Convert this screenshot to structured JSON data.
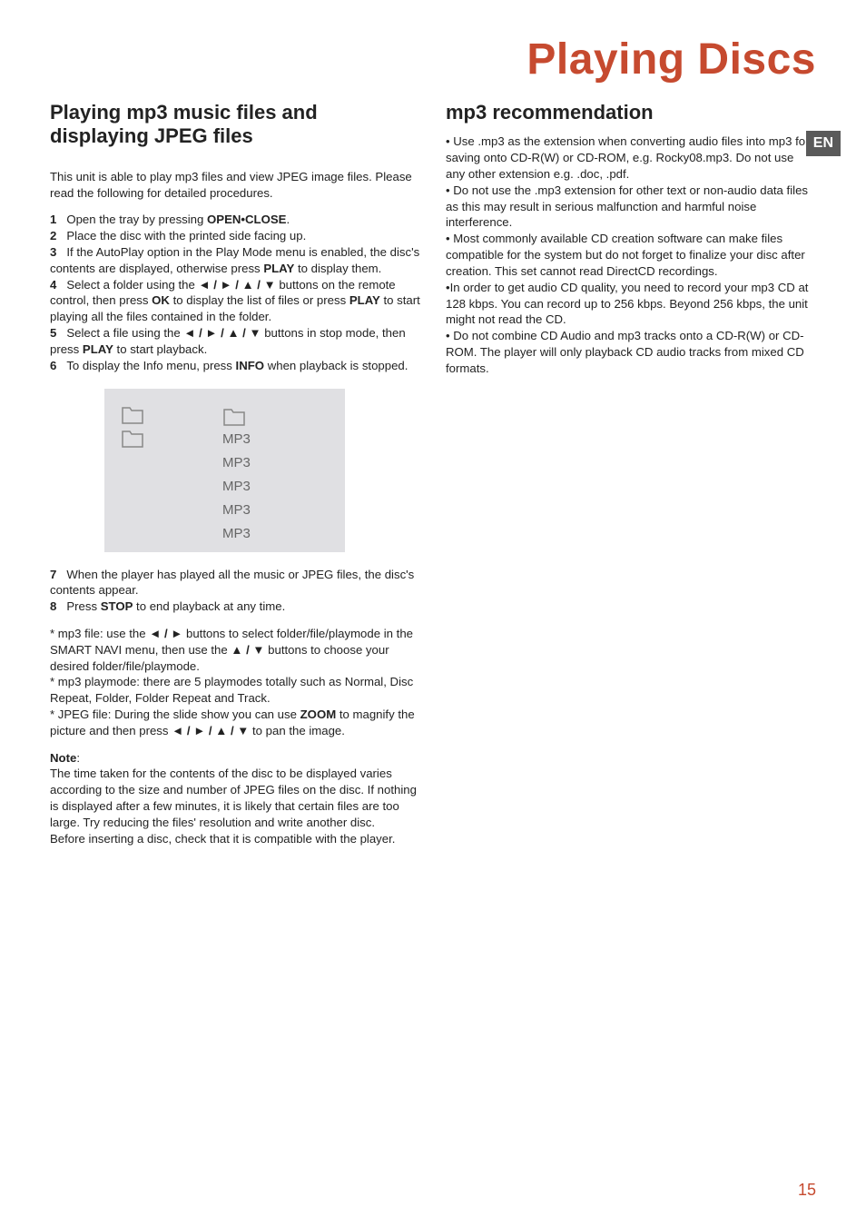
{
  "banner": "Playing Discs",
  "lang_badge": "EN",
  "page_number": "15",
  "left": {
    "heading": "Playing mp3 music files and displaying JPEG files",
    "intro": "This unit is able to play mp3 files and view JPEG image files. Please read the following for detailed procedures.",
    "s1n": "1",
    "s1a": "Open the tray by pressing ",
    "s1b": "OPEN•CLOSE",
    "s1c": ".",
    "s2n": "2",
    "s2a": "Place the disc with the printed side facing up.",
    "s3n": "3",
    "s3a": "If the AutoPlay option in the Play Mode menu is enabled, the disc's contents are displayed, otherwise press ",
    "s3b": "PLAY",
    "s3c": " to display them.",
    "s4n": "4",
    "s4a": "Select a folder using the ",
    "s4arr": "◄ / ► / ▲ / ▼",
    "s4b": " buttons on the remote control, then press ",
    "s4ok": "OK",
    "s4c": " to display the list of files or press ",
    "s4play": "PLAY",
    "s4d": " to start playing all the files contained in the folder.",
    "s5n": "5",
    "s5a": "Select a file using the ",
    "s5arr": "◄ / ► / ▲ / ▼",
    "s5b": " buttons in stop mode, then press ",
    "s5play": "PLAY",
    "s5c": " to start playback.",
    "s6n": "6",
    "s6a": "To display the Info menu, press ",
    "s6b": "INFO",
    "s6c": " when playback is stopped.",
    "diagram_labels": [
      "MP3",
      "MP3",
      "MP3",
      "MP3",
      "MP3"
    ],
    "s7n": "7",
    "s7a": "When the player has played all the music or JPEG files, the disc's contents appear.",
    "s8n": "8",
    "s8a": "Press ",
    "s8b": "STOP",
    "s8c": " to end playback at any time.",
    "ast1a": "* mp3 file: use the ",
    "ast1arr": "◄ / ►",
    "ast1b": " buttons to select folder/file/playmode in the SMART NAVI menu, then use the ",
    "ast1arr2": "▲ / ▼",
    "ast1c": " buttons to choose your desired folder/file/playmode.",
    "ast2": "* mp3 playmode: there are 5 playmodes totally such as Normal, Disc Repeat, Folder, Folder Repeat and Track.",
    "ast3a": "* JPEG file: During the slide show you can use ",
    "ast3b": "ZOOM",
    "ast3c": " to magnify the picture and then press ",
    "ast3arr": "◄ / ► / ▲ / ▼",
    "ast3d": " to pan the image.",
    "note_label": "Note",
    "note_colon": ":",
    "note_body1": "The time taken for the contents of the disc to be displayed varies according to the size and number of JPEG files on the disc. If nothing is displayed after a few minutes, it is likely that certain files are too large. Try reducing the files' resolution and write another disc.",
    "note_body2": "Before inserting a disc, check that it is compatible with the player."
  },
  "right": {
    "heading": "mp3 recommendation",
    "b1": "•  Use .mp3 as the extension when converting audio files into mp3 for saving onto CD-R(W) or CD-ROM, e.g. Rocky08.mp3. Do not use any other extension e.g. .doc, .pdf.",
    "b2": "•  Do not use the .mp3 extension for other text or non-audio data files as this may result in serious malfunction and harmful noise interference.",
    "b3": "•  Most commonly available CD creation software can make files compatible for the system but do not forget to finalize your disc after creation. This set cannot read DirectCD recordings.",
    "b4": "•In order to get audio CD quality, you need to record your mp3 CD at 128 kbps. You can record up to 256 kbps. Beyond 256 kbps, the unit might not read the CD.",
    "b5": "•  Do not combine CD Audio and mp3 tracks onto a CD-R(W) or CD-ROM. The player will only playback CD audio tracks from mixed CD formats."
  }
}
